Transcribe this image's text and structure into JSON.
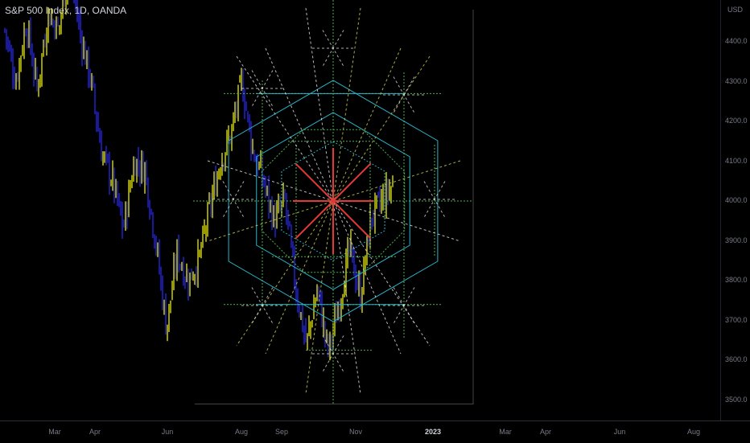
{
  "header": {
    "symbol_label": "S&P 500 Index, 1D, OANDA",
    "currency": "USD"
  },
  "colors": {
    "background": "#000000",
    "bar_yellow": "#ffff00",
    "bar_blue": "#2b2bff",
    "grid_green": "#4caf50",
    "grid_yellow": "#d4d45a",
    "grid_white": "#e6e6e6",
    "grid_cyan": "#29b6c8",
    "center_red": "#e53935"
  },
  "price_axis": {
    "ticks": [
      "4400.0",
      "4300.0",
      "4200.0",
      "4100.0",
      "4000.0",
      "3900.0",
      "3800.0",
      "3700.0",
      "3600.0",
      "3500.0"
    ]
  },
  "time_axis": {
    "ticks": [
      {
        "label": "Mar",
        "bold": false
      },
      {
        "label": "Apr",
        "bold": false
      },
      {
        "label": "Jun",
        "bold": false
      },
      {
        "label": "Aug",
        "bold": false
      },
      {
        "label": "Sep",
        "bold": false
      },
      {
        "label": "Nov",
        "bold": false
      },
      {
        "label": "2023",
        "bold": true
      },
      {
        "label": "Mar",
        "bold": false
      },
      {
        "label": "Apr",
        "bold": false
      },
      {
        "label": "Jun",
        "bold": false
      },
      {
        "label": "Aug",
        "bold": false
      }
    ]
  },
  "chart_data": {
    "type": "bar",
    "title": "S&P 500 Index, 1D, OANDA",
    "ylabel": "USD",
    "ylim": [
      3480,
      4500
    ],
    "price_path": [
      [
        "Feb",
        4430
      ],
      [
        "Feb",
        4300
      ],
      [
        "Mar",
        4450
      ],
      [
        "Mar",
        4280
      ],
      [
        "Mar",
        4470
      ],
      [
        "Apr",
        4430
      ],
      [
        "Apr",
        4600
      ],
      [
        "Apr",
        4420
      ],
      [
        "May",
        4300
      ],
      [
        "May",
        4120
      ],
      [
        "May",
        4050
      ],
      [
        "May",
        3930
      ],
      [
        "Jun",
        4100
      ],
      [
        "Jun",
        4080
      ],
      [
        "Jun",
        3900
      ],
      [
        "Jun",
        3680
      ],
      [
        "Jul",
        3870
      ],
      [
        "Jul",
        3800
      ],
      [
        "Jul",
        3850
      ],
      [
        "Jul",
        3980
      ],
      [
        "Aug",
        4100
      ],
      [
        "Aug",
        4170
      ],
      [
        "Aug",
        4300
      ],
      [
        "Aug",
        4130
      ],
      [
        "Sep",
        4050
      ],
      [
        "Sep",
        3950
      ],
      [
        "Sep",
        4000
      ],
      [
        "Sep",
        3780
      ],
      [
        "Oct",
        3640
      ],
      [
        "Oct",
        3780
      ],
      [
        "Oct",
        3620
      ],
      [
        "Oct",
        3740
      ],
      [
        "Nov",
        3880
      ],
      [
        "Nov",
        3760
      ],
      [
        "Nov",
        3960
      ],
      [
        "Nov",
        4000
      ],
      [
        "Dec",
        4040
      ]
    ],
    "drawing": {
      "center_price": 4000,
      "price_levels": [
        4270,
        4150,
        3860,
        3740,
        3625
      ],
      "low_price": 3490
    }
  }
}
